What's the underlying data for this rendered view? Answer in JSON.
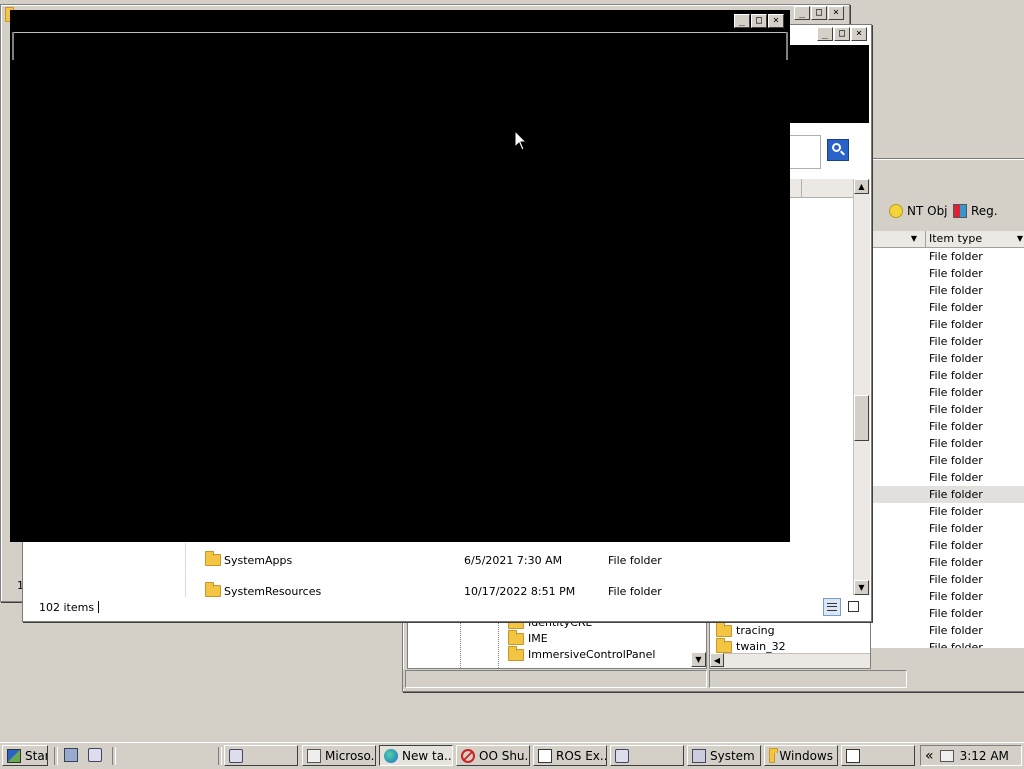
{
  "back_right_window": {
    "toolbar": {
      "ntobj_label": "NT Obj",
      "reg_label": "Reg."
    },
    "columns": {
      "type_header": "Item type"
    },
    "rows": [
      {
        "type": "File folder"
      },
      {
        "type": "File folder"
      },
      {
        "type": "File folder"
      },
      {
        "type": "File folder"
      },
      {
        "type": "File folder"
      },
      {
        "type": "File folder"
      },
      {
        "type": "File folder"
      },
      {
        "type": "File folder"
      },
      {
        "type": "File folder"
      },
      {
        "type": "File folder"
      },
      {
        "type": "File folder"
      },
      {
        "type": "File folder"
      },
      {
        "type": "File folder"
      },
      {
        "type": "File folder"
      },
      {
        "type": "File folder"
      },
      {
        "type": "File folder"
      },
      {
        "type": "File folder"
      },
      {
        "type": "File folder"
      },
      {
        "type": "File folder"
      },
      {
        "type": "File folder"
      },
      {
        "type": "File folder"
      },
      {
        "type": "File folder"
      },
      {
        "type": "File folder"
      },
      {
        "type": "File folder"
      }
    ],
    "list_names": [
      "tracing",
      "twain_32"
    ],
    "tree_items": [
      "IdentityCRL",
      "IME",
      "ImmersiveControlPanel"
    ]
  },
  "explorer_window": {
    "rows": [
      {
        "name": "SystemApps",
        "date": "6/5/2021 7:30 AM",
        "type": "File folder"
      },
      {
        "name": "SystemResources",
        "date": "10/17/2022 8:51 PM",
        "type": "File folder"
      }
    ],
    "status": {
      "item_count": "102 items"
    },
    "left_edge_char": "1"
  },
  "taskbar": {
    "start_label": "Start",
    "buttons": [
      {
        "label": "",
        "icon": "app-icon"
      },
      {
        "label": "Microso...",
        "icon": "app-icon"
      },
      {
        "label": "New ta...",
        "icon": "edge-icon"
      },
      {
        "label": "OO Shu...",
        "icon": "shutup-icon"
      },
      {
        "label": "ROS Ex...",
        "icon": "explorer-icon"
      },
      {
        "label": "",
        "icon": "app-icon"
      },
      {
        "label": "System",
        "icon": "system-icon"
      },
      {
        "label": "Windows",
        "icon": "folder-icon"
      },
      {
        "label": "",
        "icon": "app-icon"
      }
    ],
    "tray": {
      "chevron": "«",
      "clock": "3:12 AM"
    }
  },
  "colors": {
    "desktop": "#d4d0c8",
    "black_window": "#000000",
    "selected_row": "#e2e0dc",
    "search_button": "#2a62c9"
  }
}
